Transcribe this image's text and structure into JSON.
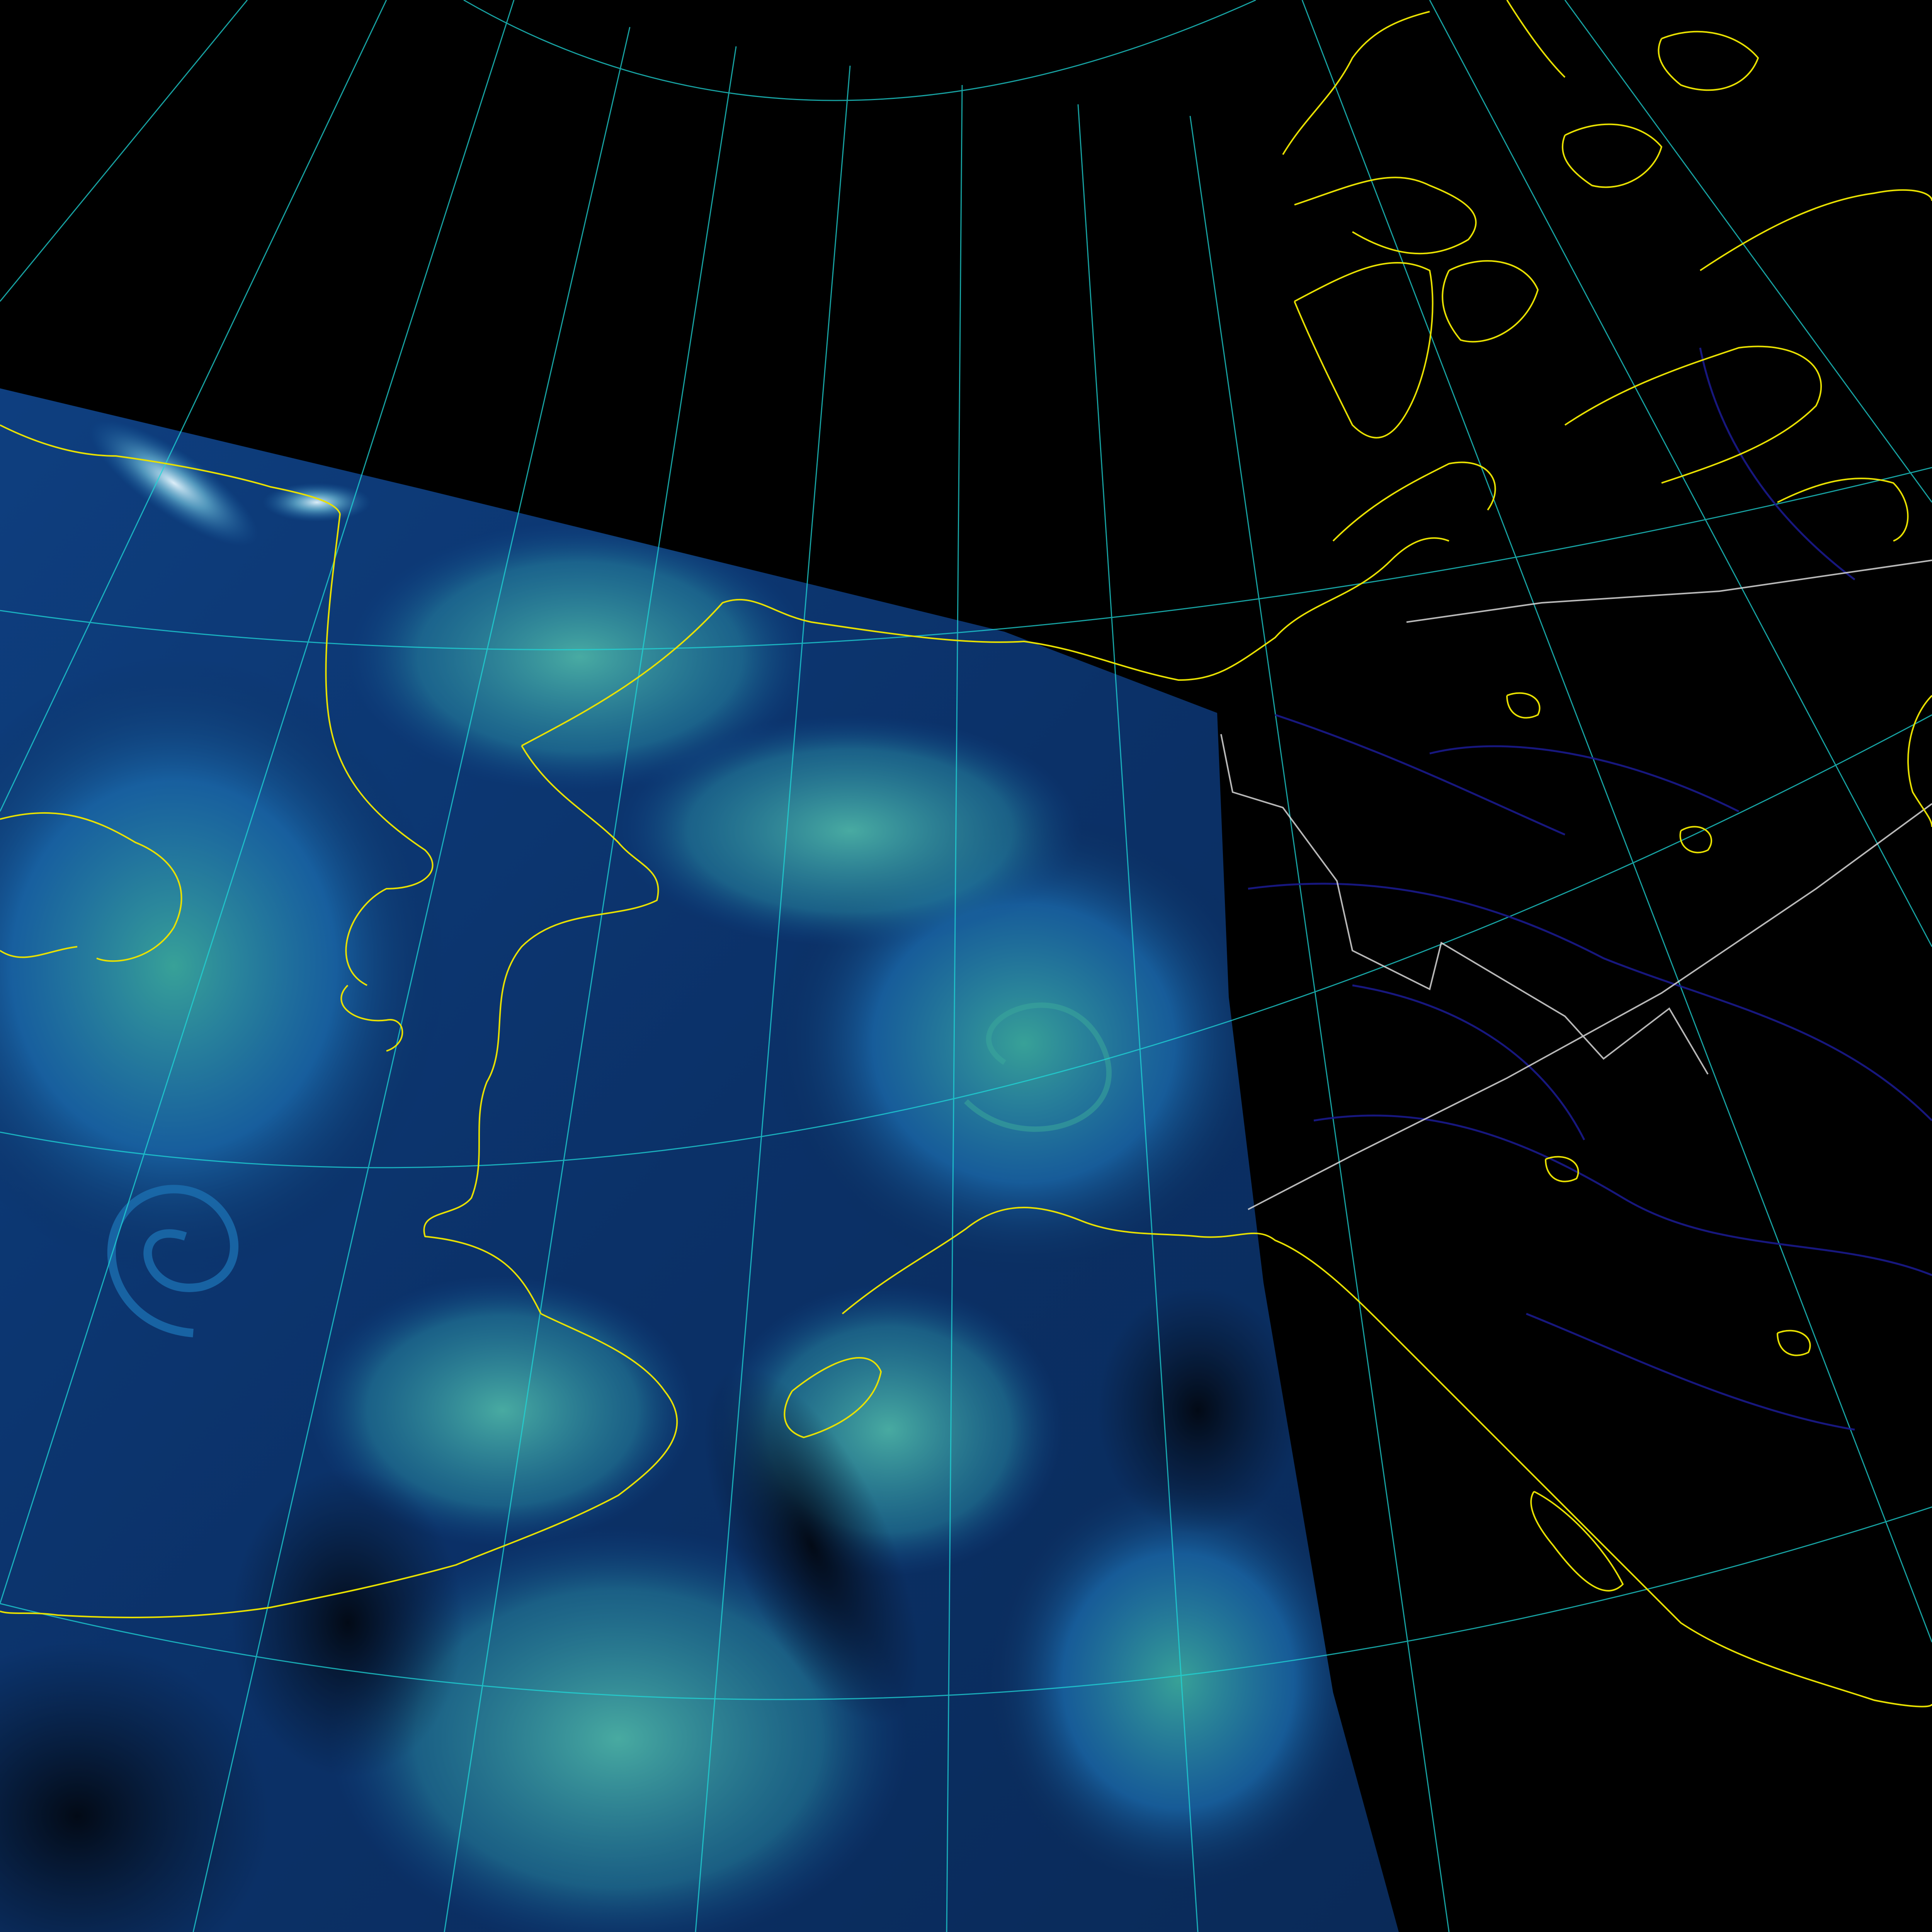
{
  "map": {
    "background_color": "#000000",
    "imagery": {
      "type": "satellite-swath",
      "palette": [
        "#061428",
        "#0b2a55",
        "#10498f",
        "#1c6fb0",
        "#2a8fa5",
        "#3aa79a",
        "#7fd3e8",
        "#e8f7ff"
      ]
    },
    "layers": [
      {
        "name": "graticule",
        "color": "#1fd8d8",
        "style": "thin lines"
      },
      {
        "name": "coastlines",
        "color": "#e8e000",
        "style": "thin lines"
      },
      {
        "name": "rivers",
        "color": "#1a1a8c",
        "style": "thin lines"
      },
      {
        "name": "political-borders",
        "color": "#d8d8d8",
        "style": "thin lines"
      }
    ]
  }
}
